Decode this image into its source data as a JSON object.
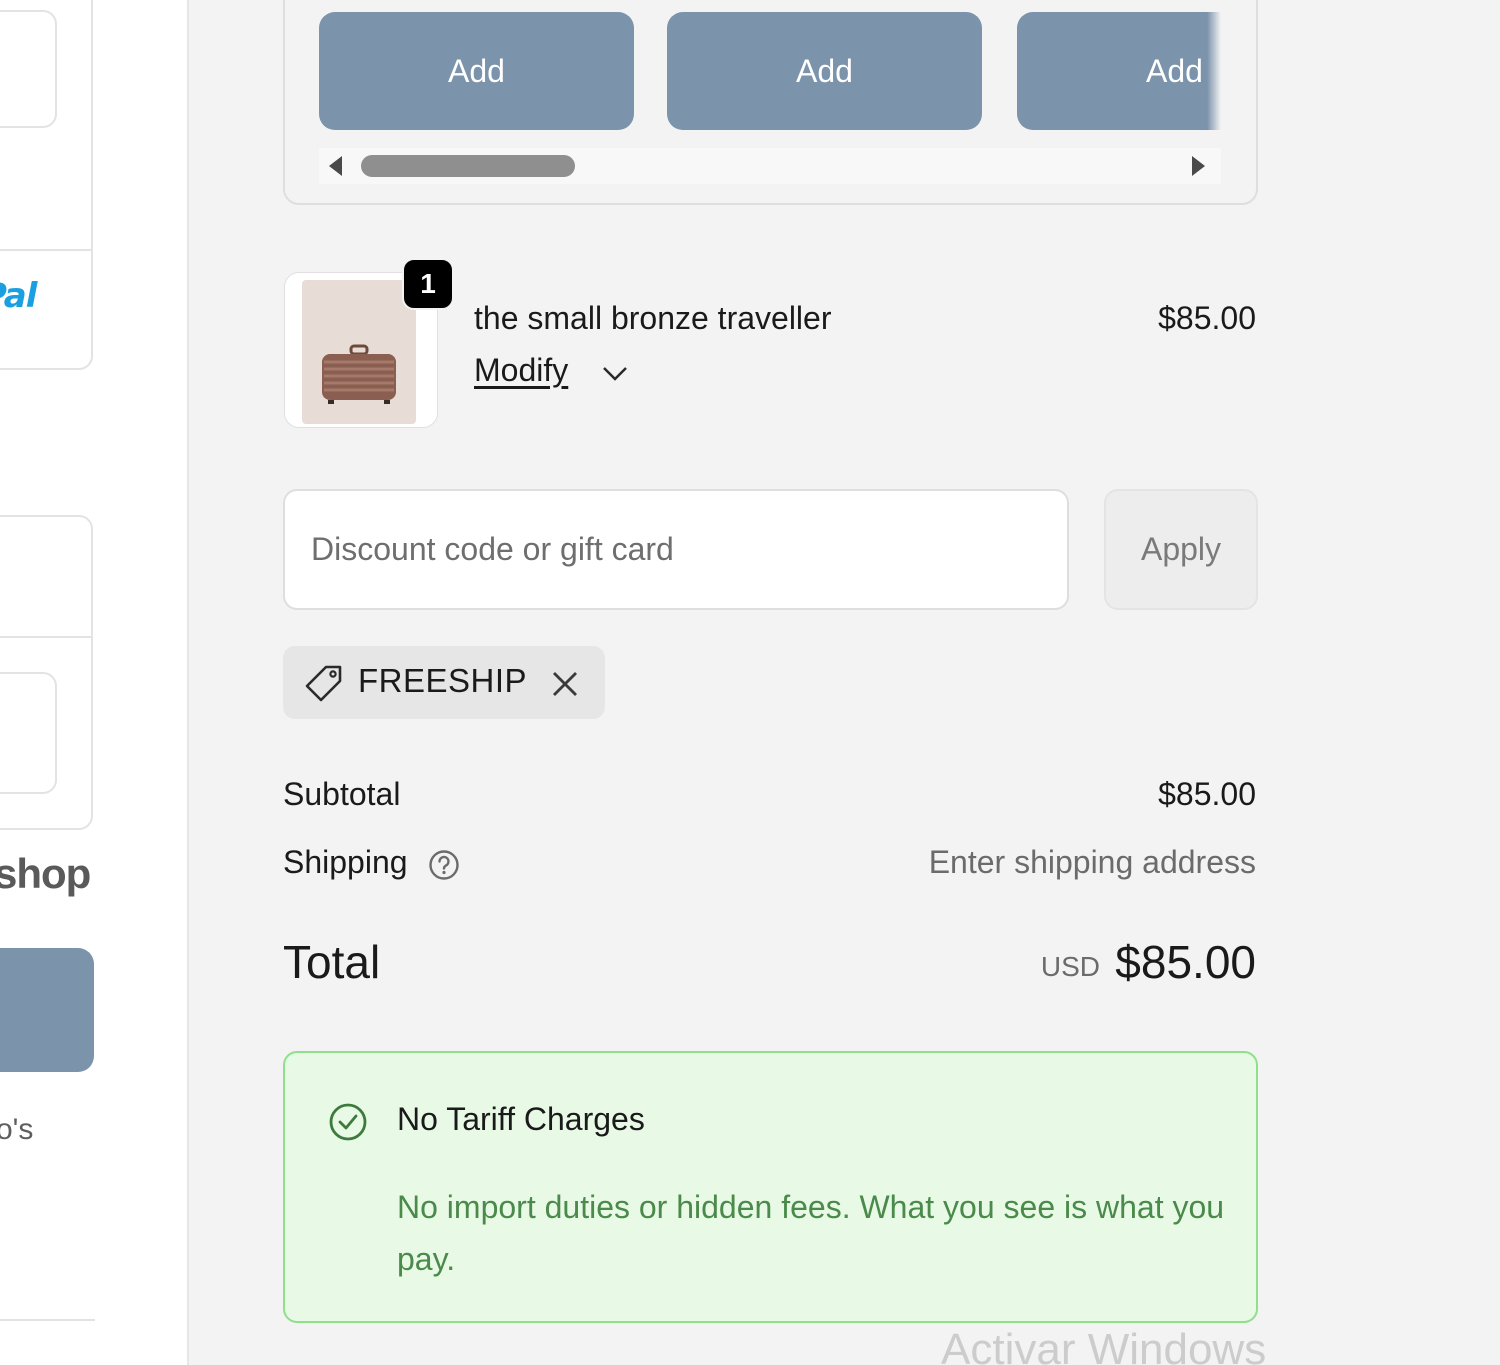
{
  "left_column": {
    "paypal_text": "Pal",
    "shop_text": "shop",
    "cut_text": "o's"
  },
  "upsell": {
    "add_buttons": [
      "Add",
      "Add",
      "Add"
    ]
  },
  "line_item": {
    "quantity": "1",
    "name": "the small bronze traveller",
    "price": "$85.00",
    "modify_label": "Modify",
    "image_icon": "suitcase-icon"
  },
  "discount": {
    "placeholder": "Discount code or gift card",
    "value": "",
    "apply_label": "Apply",
    "applied_code": "FREESHIP"
  },
  "totals": {
    "subtotal_label": "Subtotal",
    "subtotal_value": "$85.00",
    "shipping_label": "Shipping",
    "shipping_value": "Enter shipping address",
    "total_label": "Total",
    "currency": "USD",
    "total_value": "$85.00"
  },
  "notice": {
    "title": "No Tariff Charges",
    "body": "No import duties or hidden fees. What you see is what you pay."
  },
  "watermark": "Activar Windows",
  "colors": {
    "button_bg": "#7b93ab",
    "summary_bg": "#f3f3f3",
    "notice_bg": "#e8f9e6",
    "notice_border": "#8ee08a",
    "notice_text": "#4a8a4a",
    "paypal_blue": "#1a9fe0"
  }
}
